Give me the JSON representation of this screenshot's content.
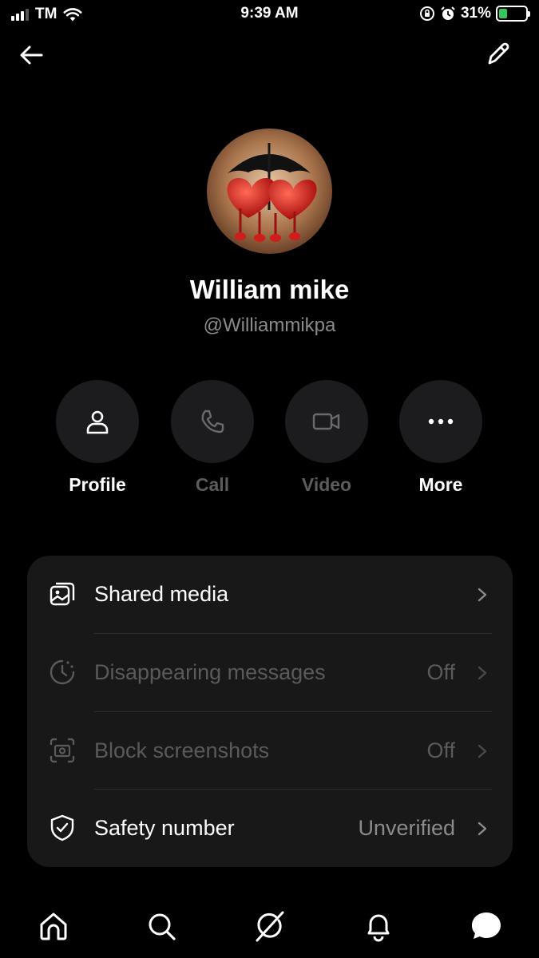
{
  "status_bar": {
    "carrier": "TM",
    "time": "9:39 AM",
    "battery_percent": "31%",
    "battery_level": 0.31,
    "battery_color": "#34c759"
  },
  "nav": {
    "back_icon": "arrow-left-icon",
    "edit_icon": "pencil-icon"
  },
  "profile": {
    "name": "William mike",
    "handle": "@Williammikpa"
  },
  "actions": [
    {
      "label": "Profile",
      "icon": "person-icon",
      "enabled": true
    },
    {
      "label": "Call",
      "icon": "phone-icon",
      "enabled": false
    },
    {
      "label": "Video",
      "icon": "video-icon",
      "enabled": false
    },
    {
      "label": "More",
      "icon": "ellipsis-icon",
      "enabled": true
    }
  ],
  "settings": [
    {
      "label": "Shared media",
      "value": "",
      "icon": "media-icon",
      "enabled": true
    },
    {
      "label": "Disappearing messages",
      "value": "Off",
      "icon": "timer-icon",
      "enabled": false
    },
    {
      "label": "Block screenshots",
      "value": "Off",
      "icon": "screenshot-icon",
      "enabled": false
    },
    {
      "label": "Safety number",
      "value": "Unverified",
      "icon": "shield-icon",
      "enabled": true
    }
  ],
  "tabs": [
    {
      "icon": "home-icon"
    },
    {
      "icon": "search-icon"
    },
    {
      "icon": "grok-icon"
    },
    {
      "icon": "bell-icon"
    },
    {
      "icon": "messages-icon"
    }
  ]
}
